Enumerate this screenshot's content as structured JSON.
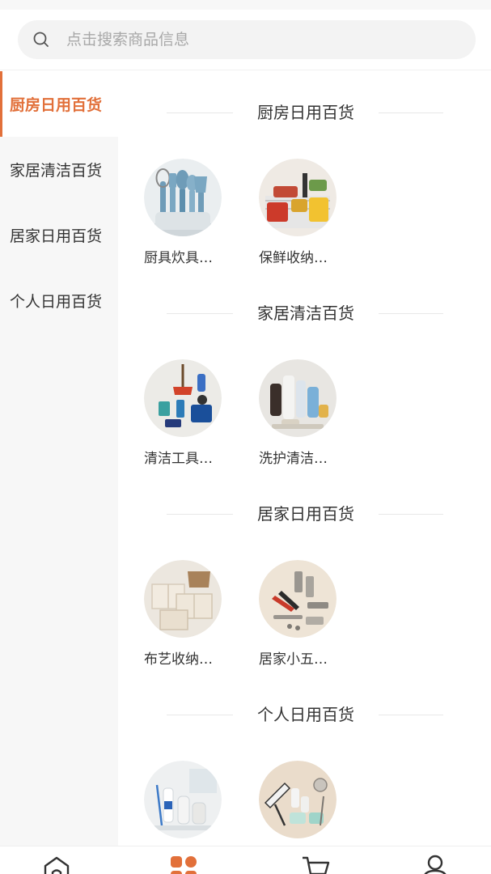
{
  "search": {
    "placeholder": "点击搜索商品信息"
  },
  "sidebar": {
    "items": [
      {
        "label": "厨房日用百货",
        "active": true
      },
      {
        "label": "家居清洁百货",
        "active": false
      },
      {
        "label": "居家日用百货",
        "active": false
      },
      {
        "label": "个人日用百货",
        "active": false
      }
    ]
  },
  "sections": [
    {
      "title": "厨房日用百货",
      "items": [
        {
          "label": "厨具炊具…",
          "image": "kitchen-utensils"
        },
        {
          "label": "保鲜收纳…",
          "image": "fresh-storage"
        }
      ]
    },
    {
      "title": "家居清洁百货",
      "items": [
        {
          "label": "清洁工具…",
          "image": "cleaning-tools"
        },
        {
          "label": "洗护清洁…",
          "image": "wash-care"
        }
      ]
    },
    {
      "title": "居家日用百货",
      "items": [
        {
          "label": "布艺收纳…",
          "image": "fabric-storage"
        },
        {
          "label": "居家小五…",
          "image": "home-hardware"
        }
      ]
    },
    {
      "title": "个人日用百货",
      "items": [
        {
          "label": "",
          "image": "personal-care"
        },
        {
          "label": "",
          "image": "travel-kit"
        }
      ]
    }
  ],
  "tabbar": {
    "items": [
      {
        "icon": "home-icon"
      },
      {
        "icon": "category-icon",
        "active": true
      },
      {
        "icon": "cart-icon"
      },
      {
        "icon": "user-icon"
      }
    ]
  },
  "colors": {
    "accent": "#e2703a",
    "sidebar_bg": "#f7f7f7",
    "text": "#333333",
    "placeholder": "#a8a8a8"
  }
}
